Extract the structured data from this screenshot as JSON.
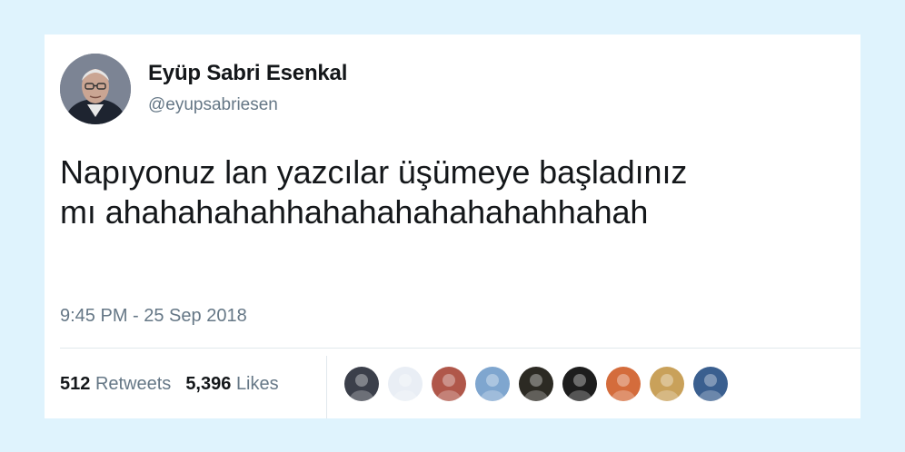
{
  "author": {
    "name": "Eyüp Sabri Esenkal",
    "handle": "@eyupsabriesen",
    "avatar_icon": "profile-photo-icon"
  },
  "tweet": {
    "text_line1": "Napıyonuz lan yazcılar üşümeye başladınız",
    "text_line2": "mı ahahahahahhahahahahahahahhahah",
    "timestamp": "9:45 PM - 25 Sep 2018"
  },
  "stats": {
    "retweets_count": "512",
    "retweets_label": "Retweets",
    "likes_count": "5,396",
    "likes_label": "Likes"
  },
  "likers": [
    {
      "icon": "liker-avatar-icon",
      "color": "#3b3f4a"
    },
    {
      "icon": "liker-avatar-icon",
      "color": "#e9eef5"
    },
    {
      "icon": "liker-avatar-icon",
      "color": "#b0574a"
    },
    {
      "icon": "liker-avatar-icon",
      "color": "#7fa6cf"
    },
    {
      "icon": "liker-avatar-icon",
      "color": "#2c2a23"
    },
    {
      "icon": "liker-avatar-icon",
      "color": "#1d1d1d"
    },
    {
      "icon": "liker-avatar-icon",
      "color": "#d46c3c"
    },
    {
      "icon": "liker-avatar-icon",
      "color": "#c9a15a"
    },
    {
      "icon": "liker-avatar-icon",
      "color": "#3a5f8f"
    }
  ],
  "colors": {
    "page_background": "#dff3fd",
    "card_background": "#ffffff",
    "primary_text": "#14171a",
    "secondary_text": "#657786",
    "divider": "#e1e8ed"
  }
}
